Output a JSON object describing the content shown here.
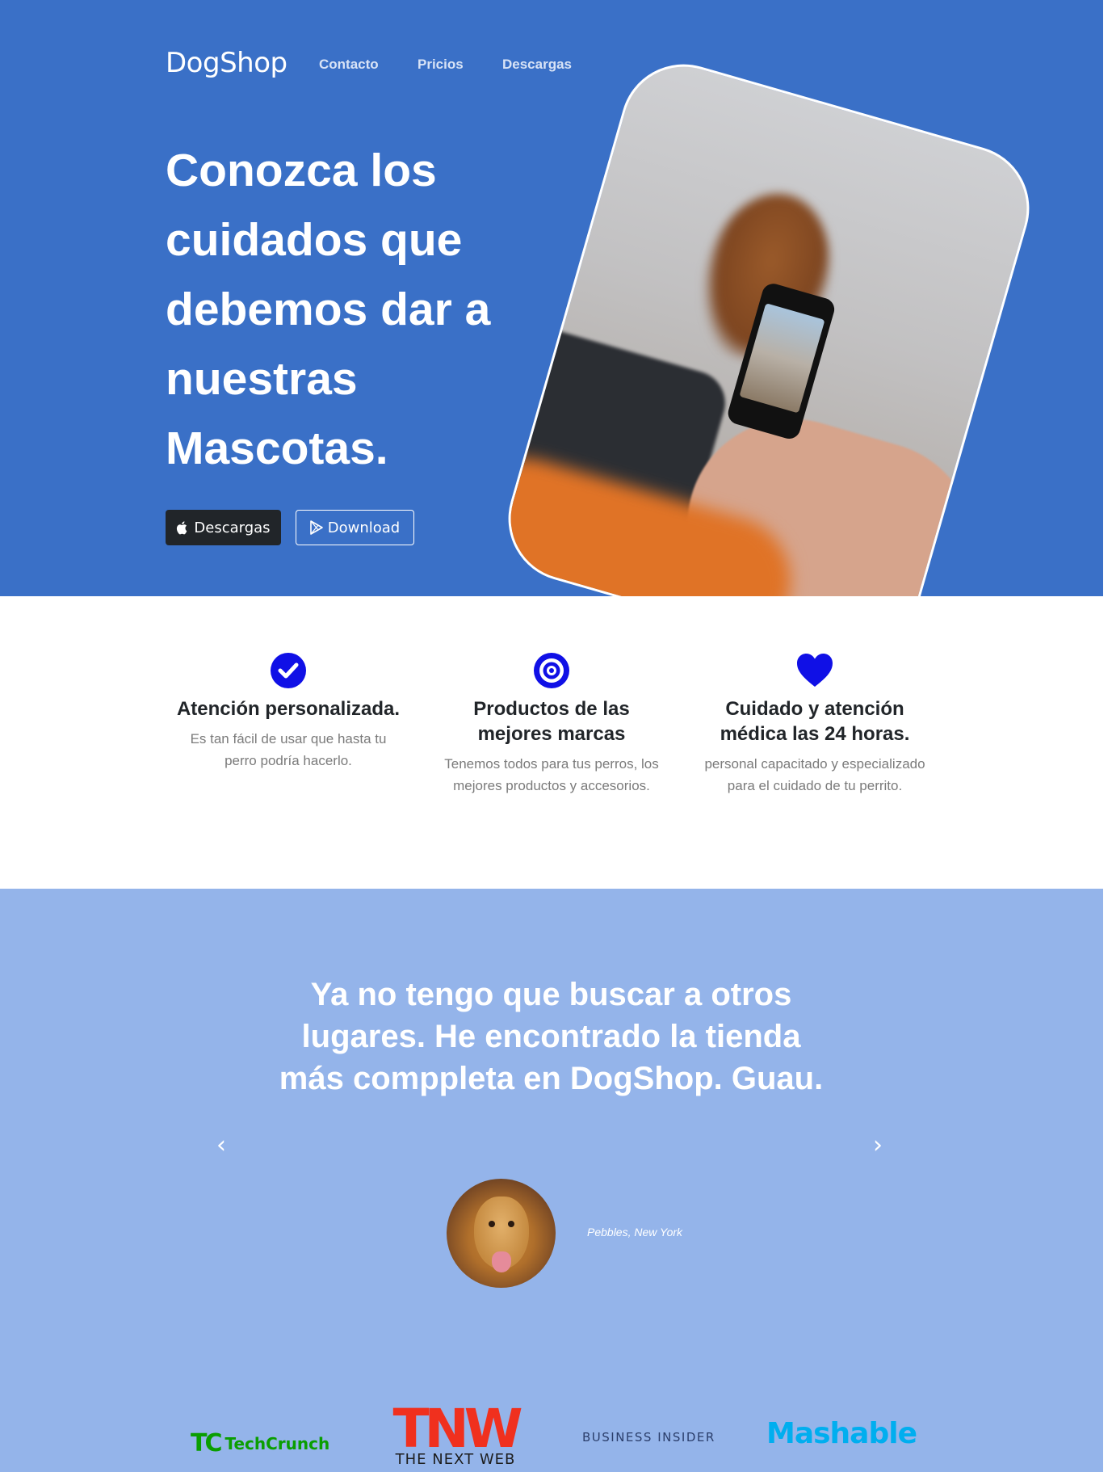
{
  "header": {
    "brand": "DogShop",
    "nav": [
      "Contacto",
      "Pricios",
      "Descargas"
    ]
  },
  "hero": {
    "title": "Conozca los cuidados que debemos dar a nuestras Mascotas.",
    "buttons": {
      "apple_label": "Descargas",
      "play_label": "Download"
    }
  },
  "features": [
    {
      "icon": "check-circle-icon",
      "title": "Atención personalizada.",
      "text": "Es tan fácil de usar que hasta tu perro podría hacerlo."
    },
    {
      "icon": "target-icon",
      "title": "Productos de las mejores marcas",
      "text": "Tenemos todos para tus perros, los mejores productos y accesorios."
    },
    {
      "icon": "heart-icon",
      "title": "Cuidado y atención médica las 24 horas.",
      "text": "personal capacitado y especializado para el cuidado de tu perrito."
    }
  ],
  "testimonial": {
    "quote": "Ya no tengo que buscar a otros lugares. He encontrado la tienda más comppleta en DogShop. Guau.",
    "author": "Pebbles, New York"
  },
  "press": {
    "techcrunch_mark": "TC",
    "techcrunch": "TechCrunch",
    "tnw_mark": "TNW",
    "tnw": "THE NEXT WEB",
    "business_insider": "BUSINESS INSIDER",
    "mashable": "Mashable"
  },
  "colors": {
    "hero_bg": "#3a70c7",
    "testimonial_bg": "#94b4ea",
    "feature_icon": "#1010e6",
    "dark_button": "#212529"
  }
}
